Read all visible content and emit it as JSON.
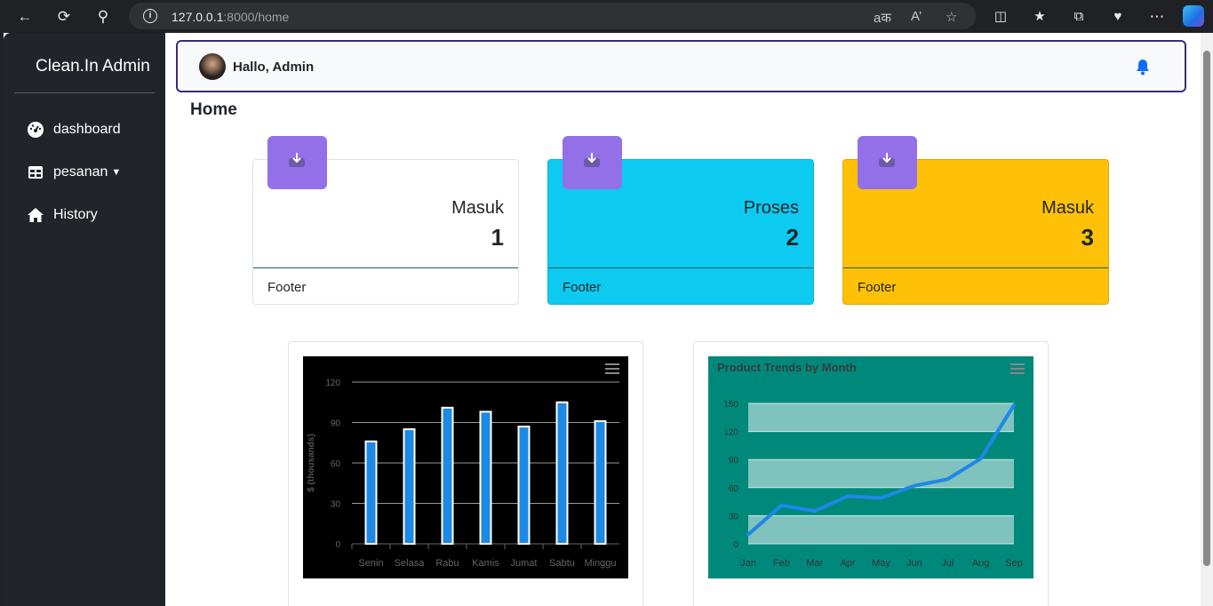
{
  "browser": {
    "url_host": "127.0.0.1",
    "url_rest": ":8000/home"
  },
  "sidebar": {
    "brand": "Clean.In Admin",
    "items": [
      {
        "label": "dashboard",
        "icon": "dashboard-icon"
      },
      {
        "label": "pesanan",
        "icon": "table-icon"
      },
      {
        "label": "History",
        "icon": "home-icon"
      }
    ]
  },
  "topbar": {
    "greeting": "Hallo, Admin"
  },
  "page": {
    "title": "Home"
  },
  "cards": [
    {
      "label": "Masuk",
      "count": "1",
      "footer": "Footer",
      "color": "#ffffff"
    },
    {
      "label": "Proses",
      "count": "2",
      "footer": "Footer",
      "color": "#0dcaf0"
    },
    {
      "label": "Masuk",
      "count": "3",
      "footer": "Footer",
      "color": "#ffc107"
    }
  ],
  "chart_data": [
    {
      "type": "bar",
      "categories": [
        "Senin",
        "Selasa",
        "Rabu",
        "Kamis",
        "Jumat",
        "Sabtu",
        "Minggu"
      ],
      "values": [
        76,
        85,
        101,
        98,
        87,
        105,
        91
      ],
      "ylabel": "$ (thousands)",
      "ylim": [
        0,
        120
      ],
      "yticks": [
        0,
        30,
        60,
        90,
        120
      ],
      "bar_color": "#1e88e5",
      "background": "#000000"
    },
    {
      "type": "line",
      "title": "Product Trends by Month",
      "categories": [
        "Jan",
        "Feb",
        "Mar",
        "Apr",
        "May",
        "Jun",
        "Jul",
        "Aug",
        "Sep"
      ],
      "values": [
        10,
        41,
        35,
        51,
        49,
        62,
        69,
        91,
        148
      ],
      "ylim": [
        0,
        150
      ],
      "yticks": [
        0,
        30,
        60,
        90,
        120,
        150
      ],
      "line_color": "#1e88e5",
      "background": "#00897b"
    }
  ]
}
